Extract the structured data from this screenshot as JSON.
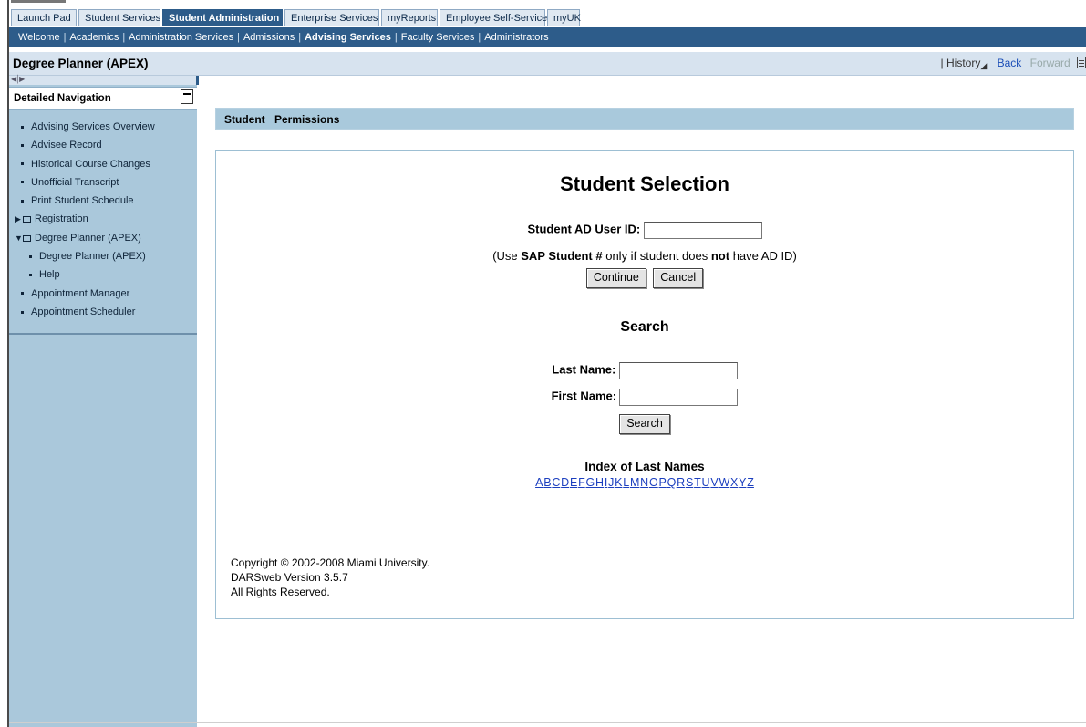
{
  "top_tabs": [
    {
      "label": "Launch Pad",
      "active": false
    },
    {
      "label": "Student Services",
      "active": false
    },
    {
      "label": "Student Administration",
      "active": true
    },
    {
      "label": "Enterprise Services",
      "active": false
    },
    {
      "label": "myReports",
      "active": false
    },
    {
      "label": "Employee Self-Service",
      "active": false
    },
    {
      "label": "myUK",
      "active": false
    }
  ],
  "sub_nav": [
    {
      "label": "Welcome",
      "active": false
    },
    {
      "label": "Academics",
      "active": false
    },
    {
      "label": "Administration Services",
      "active": false
    },
    {
      "label": "Admissions",
      "active": false
    },
    {
      "label": "Advising Services",
      "active": true
    },
    {
      "label": "Faculty Services",
      "active": false
    },
    {
      "label": "Administrators",
      "active": false
    }
  ],
  "page_title": "Degree Planner (APEX)",
  "history": {
    "history_label": "History",
    "back_label": "Back",
    "forward_label": "Forward"
  },
  "sidebar": {
    "title": "Detailed Navigation",
    "items": [
      {
        "label": "Advising Services Overview",
        "kind": "item"
      },
      {
        "label": "Advisee Record",
        "kind": "item"
      },
      {
        "label": "Historical Course Changes",
        "kind": "item"
      },
      {
        "label": "Unofficial Transcript",
        "kind": "item"
      },
      {
        "label": "Print Student Schedule",
        "kind": "item"
      },
      {
        "label": "Registration",
        "kind": "folder-collapsed"
      },
      {
        "label": "Degree Planner (APEX)",
        "kind": "folder-expanded"
      },
      {
        "label": "Degree Planner (APEX)",
        "kind": "sub"
      },
      {
        "label": "Help",
        "kind": "sub"
      },
      {
        "label": "Appointment Manager",
        "kind": "item"
      },
      {
        "label": "Appointment Scheduler",
        "kind": "item"
      }
    ]
  },
  "menu": {
    "student_label": "Student",
    "permissions_label": "Permissions"
  },
  "selection": {
    "title": "Student Selection",
    "ad_user_id_label": "Student AD User ID:",
    "ad_user_id_value": "",
    "note_prefix": "(Use ",
    "note_bold1": "SAP Student #",
    "note_middle": " only if student does ",
    "note_bold2": "not",
    "note_suffix": " have AD ID)",
    "continue_label": "Continue",
    "cancel_label": "Cancel"
  },
  "search": {
    "title": "Search",
    "last_name_label": "Last Name:",
    "last_name_value": "",
    "first_name_label": "First Name:",
    "first_name_value": "",
    "search_button_label": "Search"
  },
  "index": {
    "title": "Index of Last Names",
    "letters": [
      "A",
      "B",
      "C",
      "D",
      "E",
      "F",
      "G",
      "H",
      "I",
      "J",
      "K",
      "L",
      "M",
      "N",
      "O",
      "P",
      "Q",
      "R",
      "S",
      "T",
      "U",
      "V",
      "W",
      "X",
      "Y",
      "Z"
    ]
  },
  "footer": {
    "line1": "Copyright © 2002-2008 Miami University.",
    "line2": "DARSweb Version 3.5.7",
    "line3": "All Rights Reserved."
  },
  "colors": {
    "nav_blue": "#2d5c8a",
    "sidebar_blue": "#aac8db",
    "title_bar": "#d7e3ef",
    "link_blue": "#1c3fbf"
  }
}
